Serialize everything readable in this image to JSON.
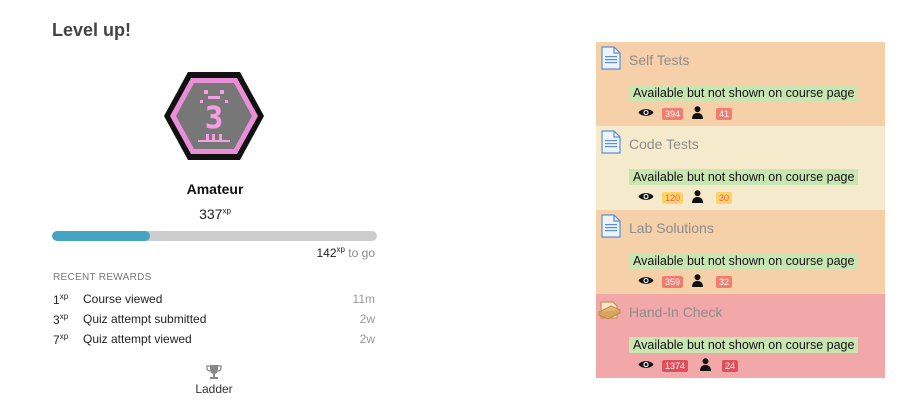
{
  "block": {
    "title": "Level up!",
    "level_name": "Amateur",
    "level_number": "3",
    "points_value": "337",
    "points_unit": "xp",
    "progress_fraction": 0.3,
    "to_go_value": "142",
    "to_go_unit": "xp",
    "to_go_label": "to go",
    "recent_rewards_heading": "RECENT REWARDS",
    "rewards": [
      {
        "points": "1",
        "unit": "xp",
        "text": "Course viewed",
        "time": "11m"
      },
      {
        "points": "3",
        "unit": "xp",
        "text": "Quiz attempt submitted",
        "time": "2w"
      },
      {
        "points": "7",
        "unit": "xp",
        "text": "Quiz attempt viewed",
        "time": "2w"
      }
    ],
    "ladder_label": "Ladder",
    "ladder_icon": "trophy-icon"
  },
  "activities": [
    {
      "name": "Self Tests",
      "icon": "file-icon",
      "status": "Available but not shown on course page",
      "views": "394",
      "users": "41",
      "bg": "#f5d0a9",
      "badge_views_bg": "#f27c6e",
      "badge_users_bg": "#f27c6e",
      "badge_text": "#ffffff"
    },
    {
      "name": "Code Tests",
      "icon": "file-icon",
      "status": "Available but not shown on course page",
      "views": "120",
      "users": "30",
      "bg": "#f5ebcc",
      "badge_views_bg": "#fcd36a",
      "badge_users_bg": "#fcd36a",
      "badge_text": "#e06a4a"
    },
    {
      "name": "Lab Solutions",
      "icon": "file-icon",
      "status": "Available but not shown on course page",
      "views": "359",
      "users": "32",
      "bg": "#f5d0a9",
      "badge_views_bg": "#f27c6e",
      "badge_users_bg": "#f27c6e",
      "badge_text": "#ffffff"
    },
    {
      "name": "Hand-In Check",
      "icon": "assignment-icon",
      "status": "Available but not shown on course page",
      "views": "1374",
      "users": "24",
      "bg": "#f2a8a8",
      "badge_views_bg": "#e0505a",
      "badge_users_bg": "#e0505a",
      "badge_text": "#ffffff"
    }
  ],
  "colors": {
    "progress_fill": "#45a4c2",
    "progress_track": "#cccccc",
    "status_bg": "#c9e6b2"
  }
}
